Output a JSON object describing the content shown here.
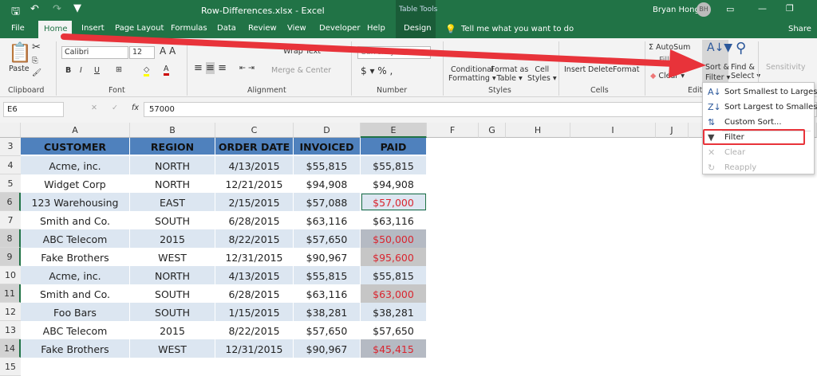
{
  "title_bar": {
    "file_title": "Row-Differences.xlsx  -  Excel",
    "context": "Table Tools",
    "user": "Bryan Hong",
    "initials": "BH"
  },
  "tabs": [
    "File",
    "Home",
    "Insert",
    "Page Layout",
    "Formulas",
    "Data",
    "Review",
    "View",
    "Developer",
    "Help",
    "Design"
  ],
  "tell_me": "Tell me what you want to do",
  "share": "Share",
  "ribbon": {
    "paste": "Paste",
    "font": "Calibri",
    "size": "12",
    "wrap": "Wrap Text",
    "merge": "Merge & Center",
    "number_format": "Currency",
    "cond": "Conditional",
    "cond2": "Formatting",
    "fmt_table": "Format as",
    "fmt_table2": "Table",
    "cell_styles": "Cell",
    "cell_styles2": "Styles",
    "insert": "Insert",
    "delete": "Delete",
    "format": "Format",
    "autosum": "AutoSum",
    "fill": "Fill",
    "clear": "Clear",
    "sort": "Sort &",
    "sort2": "Filter",
    "find": "Find &",
    "find2": "Select",
    "sensitivity": "Sensitivity",
    "groups": {
      "clipboard": "Clipboard",
      "font": "Font",
      "alignment": "Alignment",
      "number": "Number",
      "styles": "Styles",
      "cells": "Cells",
      "editing": "Editi"
    }
  },
  "formula_bar": {
    "name_box": "E6",
    "value": "57000",
    "fx": "fx"
  },
  "columns": [
    "A",
    "B",
    "C",
    "D",
    "E",
    "F",
    "G",
    "H",
    "I",
    "J"
  ],
  "table": {
    "headers": [
      "CUSTOMER",
      "REGION",
      "ORDER DATE",
      "INVOICED",
      "PAID"
    ],
    "rows": [
      {
        "n": "4",
        "c": [
          "Acme, inc.",
          "NORTH",
          "4/13/2015",
          "$55,815",
          "$55,815"
        ],
        "diff": false
      },
      {
        "n": "5",
        "c": [
          "Widget Corp",
          "NORTH",
          "12/21/2015",
          "$94,908",
          "$94,908"
        ],
        "diff": false
      },
      {
        "n": "6",
        "c": [
          "123 Warehousing",
          "EAST",
          "2/15/2015",
          "$57,088",
          "$57,000"
        ],
        "diff": true
      },
      {
        "n": "7",
        "c": [
          "Smith and Co.",
          "SOUTH",
          "6/28/2015",
          "$63,116",
          "$63,116"
        ],
        "diff": false
      },
      {
        "n": "8",
        "c": [
          "ABC Telecom",
          "2015",
          "8/22/2015",
          "$57,650",
          "$50,000"
        ],
        "diff": true
      },
      {
        "n": "9",
        "c": [
          "Fake Brothers",
          "WEST",
          "12/31/2015",
          "$90,967",
          "$95,600"
        ],
        "diff": true
      },
      {
        "n": "10",
        "c": [
          "Acme, inc.",
          "NORTH",
          "4/13/2015",
          "$55,815",
          "$55,815"
        ],
        "diff": false
      },
      {
        "n": "11",
        "c": [
          "Smith and Co.",
          "SOUTH",
          "6/28/2015",
          "$63,116",
          "$63,000"
        ],
        "diff": true
      },
      {
        "n": "12",
        "c": [
          "Foo Bars",
          "SOUTH",
          "1/15/2015",
          "$38,281",
          "$38,281"
        ],
        "diff": false
      },
      {
        "n": "13",
        "c": [
          "ABC Telecom",
          "2015",
          "8/22/2015",
          "$57,650",
          "$57,650"
        ],
        "diff": false
      },
      {
        "n": "14",
        "c": [
          "Fake Brothers",
          "WEST",
          "12/31/2015",
          "$90,967",
          "$45,415"
        ],
        "diff": true
      }
    ]
  },
  "menu": [
    {
      "label": "Sort Smallest to Largest",
      "icon": "sort-az-icon",
      "enabled": true
    },
    {
      "label": "Sort Largest to Smallest",
      "icon": "sort-za-icon",
      "enabled": true
    },
    {
      "label": "Custom Sort...",
      "icon": "custom-sort-icon",
      "enabled": true
    },
    {
      "label": "Filter",
      "icon": "filter-icon",
      "enabled": true
    },
    {
      "label": "Clear",
      "icon": "clear-filter-icon",
      "enabled": false
    },
    {
      "label": "Reapply",
      "icon": "reapply-icon",
      "enabled": false
    }
  ],
  "colors": {
    "excel_green": "#217346",
    "header_blue": "#4f81bd",
    "band": "#dce6f1",
    "diff_red": "#d9252f",
    "annotation": "#e8333a"
  }
}
